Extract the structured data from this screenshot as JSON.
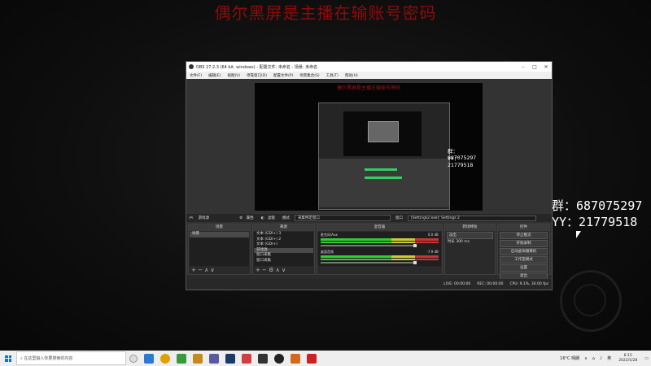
{
  "overlay": {
    "title": "偶尔黑屏是主播在输账号密码",
    "group_line": "群：687075297",
    "yy_line": "YY：21779518"
  },
  "obs": {
    "window_title": "OBS 27.2.3 (64 bit, windows) - 配置文件: 未命名 - 场景: 未命名",
    "menus": [
      "文件(F)",
      "编辑(E)",
      "视图(V)",
      "停靠窗口(D)",
      "配置文件(P)",
      "场景集合(S)",
      "工具(T)",
      "帮助(H)"
    ],
    "canvas": {
      "title": "偶尔黑屏是主播在输账号密码",
      "group_line": "群：687075297",
      "yy_line": "YY：21779518"
    },
    "source_bar": {
      "game_source": "游戏源",
      "properties": "属性",
      "filters": "滤镜",
      "mode_label": "模式",
      "mode_value": "采集特定窗口",
      "window_label": "窗口",
      "window_value": "[Settings2.exe]: Settings 2"
    },
    "docks": {
      "scenes": {
        "header": "场景",
        "items": [
          "场景"
        ]
      },
      "sources": {
        "header": "来源",
        "items": [
          "文本 (GDI+) 3",
          "文本 (GDI+) 2",
          "文本 (GDI+)",
          "游戏源",
          "窗口采集",
          "窗口采集"
        ]
      },
      "mixer": {
        "header": "混音器",
        "channels": [
          {
            "name": "麦克风/Aux",
            "db": "0.0 dB"
          },
          {
            "name": "桌面音频",
            "db": "-7.9 dB"
          }
        ]
      },
      "transitions": {
        "header": "转场特效",
        "type": "淡出",
        "duration_label": "时长",
        "duration_value": "300 ms"
      },
      "controls": {
        "header": "控件",
        "buttons": [
          "停止推流",
          "开始录制",
          "启动虚拟摄像机",
          "工作室模式",
          "设置",
          "退出"
        ]
      }
    },
    "status": {
      "live": "LIVE: 00:00:00",
      "rec": "REC: 00:00:00",
      "cpu": "CPU: 9.1%, 30.00 fps"
    }
  },
  "taskbar": {
    "search_placeholder": "在这里输入你要搜索的内容",
    "weather": "16°C 晴朗",
    "ime": "英",
    "time": "6:15",
    "date": "2022/5/28"
  }
}
